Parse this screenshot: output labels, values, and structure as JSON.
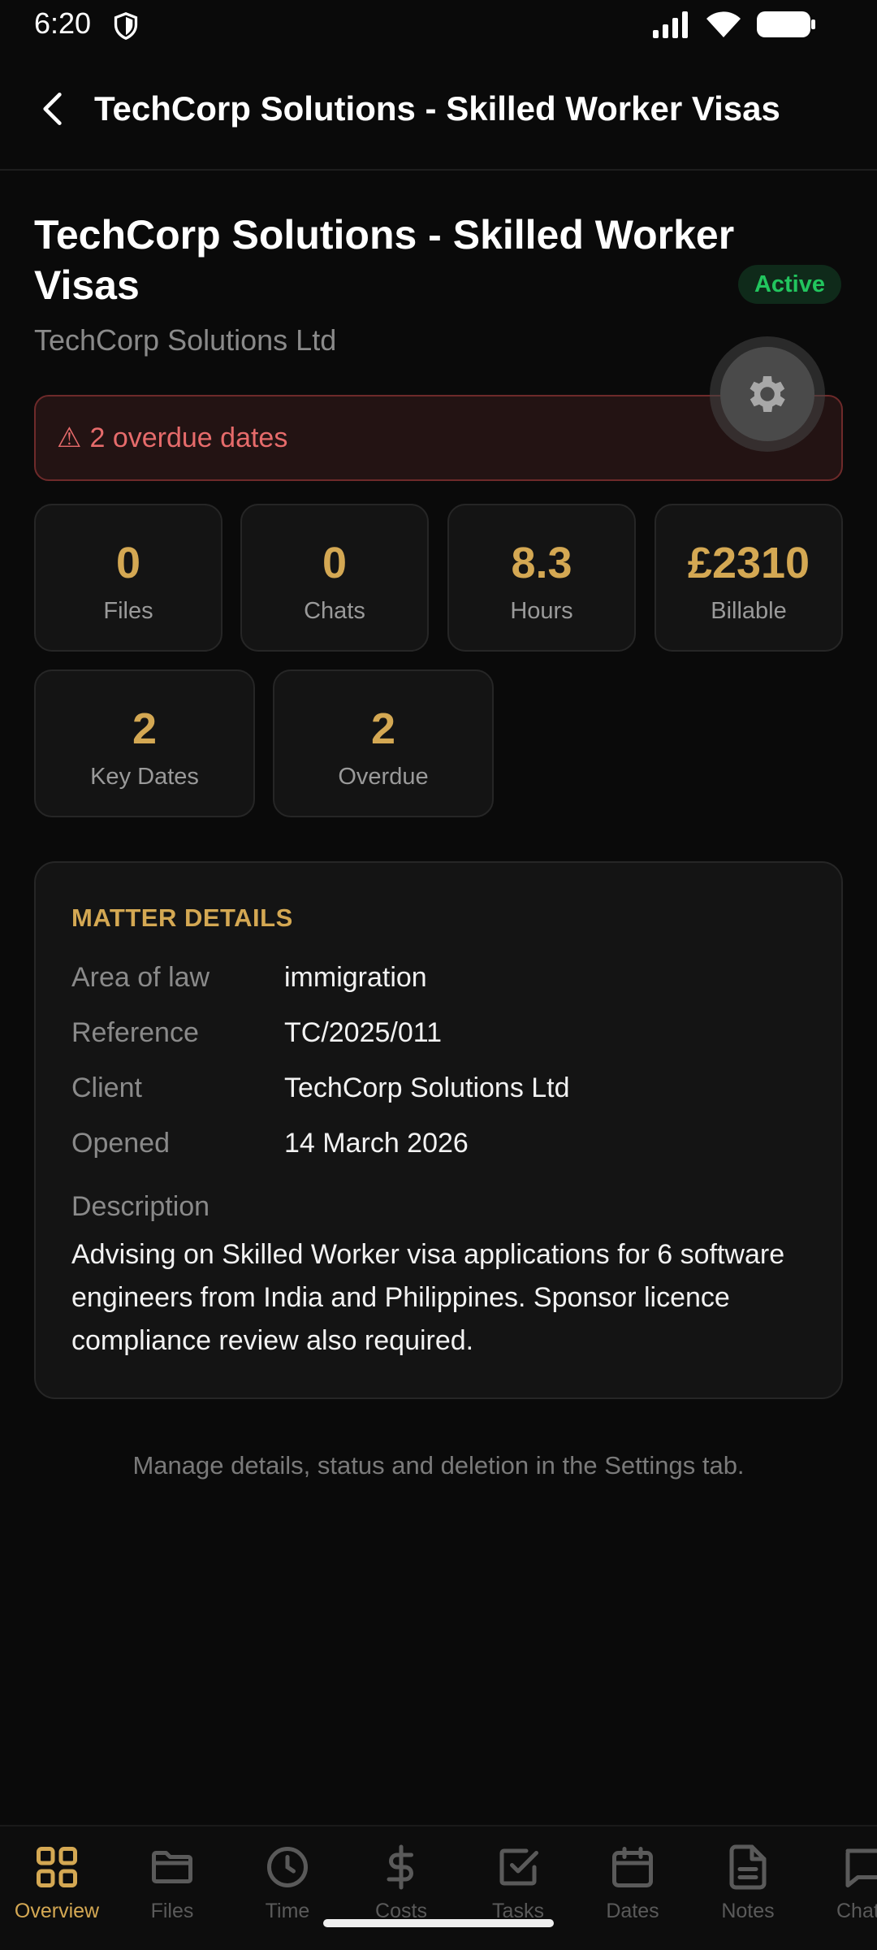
{
  "status_bar": {
    "time": "6:20"
  },
  "app_bar": {
    "title": "TechCorp Solutions - Skilled Worker Visas"
  },
  "matter": {
    "title": "TechCorp Solutions - Skilled Worker Visas",
    "status": "Active",
    "client": "TechCorp Solutions Ltd"
  },
  "alert": {
    "icon": "⚠",
    "text": "2 overdue dates"
  },
  "stats": [
    {
      "value": "0",
      "label": "Files"
    },
    {
      "value": "0",
      "label": "Chats"
    },
    {
      "value": "8.3",
      "label": "Hours"
    },
    {
      "value": "£2310",
      "label": "Billable"
    },
    {
      "value": "2",
      "label": "Key Dates"
    },
    {
      "value": "2",
      "label": "Overdue"
    }
  ],
  "details": {
    "heading": "MATTER DETAILS",
    "rows": [
      {
        "label": "Area of law",
        "value": "immigration"
      },
      {
        "label": "Reference",
        "value": "TC/2025/011"
      },
      {
        "label": "Client",
        "value": "TechCorp Solutions Ltd"
      },
      {
        "label": "Opened",
        "value": "14 March 2026"
      }
    ],
    "description_label": "Description",
    "description": "Advising on Skilled Worker visa applications for 6 software engineers from India and Philippines. Sponsor licence compliance review also required."
  },
  "footer_hint": "Manage details, status and deletion in the Settings tab.",
  "tabs": [
    {
      "label": "Overview",
      "icon": "grid-icon",
      "active": true
    },
    {
      "label": "Files",
      "icon": "folder-icon"
    },
    {
      "label": "Time",
      "icon": "clock-icon"
    },
    {
      "label": "Costs",
      "icon": "dollar-icon"
    },
    {
      "label": "Tasks",
      "icon": "checkbox-icon"
    },
    {
      "label": "Dates",
      "icon": "calendar-icon"
    },
    {
      "label": "Notes",
      "icon": "document-icon"
    },
    {
      "label": "Chat",
      "icon": "chat-icon"
    }
  ],
  "colors": {
    "background": "#0a0a0a",
    "accent": "#d4a853",
    "active_status": "#22c55e",
    "alert": "#e66b6b"
  }
}
